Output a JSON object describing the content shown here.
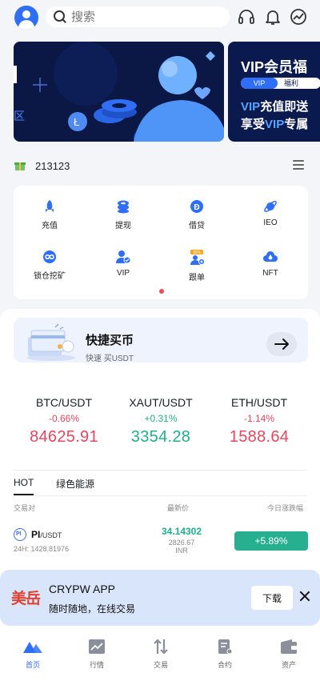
{
  "header": {
    "search_placeholder": "搜索",
    "icons": [
      "headset-icon",
      "bell-icon",
      "chart-globe-icon"
    ]
  },
  "banners": {
    "vip": {
      "title": "VIP会员福",
      "pill_left": "VIP",
      "pill_right": "福利",
      "line1_a": "VIP",
      "line1_b": "充值即送",
      "line2_a": "享受",
      "line2_b": "VIP",
      "line2_c": "专属"
    }
  },
  "notice": {
    "text": "213123"
  },
  "quick_grid": [
    {
      "label": "充值",
      "icon": "rocket-icon"
    },
    {
      "label": "提现",
      "icon": "coins-stack-icon"
    },
    {
      "label": "借贷",
      "icon": "dollar-coin-icon"
    },
    {
      "label": "IEO",
      "icon": "planet-icon"
    },
    {
      "label": "锁仓挖矿",
      "icon": "infinity-lock-icon"
    },
    {
      "label": "VIP",
      "icon": "user-check-icon"
    },
    {
      "label": "跟单",
      "icon": "follow-order-icon",
      "badge": "30%"
    },
    {
      "label": "NFT",
      "icon": "cloud-drop-icon"
    }
  ],
  "quick_buy": {
    "title": "快捷买币",
    "subtitle": "快速 买USDT"
  },
  "tickers": [
    {
      "pair": "BTC/USDT",
      "change": "-0.66%",
      "price": "84625.91",
      "trend": "down"
    },
    {
      "pair": "XAUT/USDT",
      "change": "+0.31%",
      "price": "3354.28",
      "trend": "up"
    },
    {
      "pair": "ETH/USDT",
      "change": "-1.14%",
      "price": "1588.64",
      "trend": "down"
    }
  ],
  "market_tabs": [
    {
      "label": "HOT",
      "active": true
    },
    {
      "label": "绿色能源",
      "active": false
    }
  ],
  "market_columns": {
    "pair": "交易对",
    "price": "最新价",
    "change": "今日涨跌幅"
  },
  "market_rows": [
    {
      "icon_text": "PI",
      "base": "PI",
      "quote": "/USDT",
      "volume": "24H: 1428.81976",
      "price": "34.14302",
      "price_local": "2826.67",
      "currency": "INR",
      "change": "+5.89%"
    }
  ],
  "app_banner": {
    "logo": "美岳",
    "title": "CRYPW APP",
    "subtitle": "随时随地，在线交易",
    "download": "下载"
  },
  "nav": [
    {
      "label": "首页",
      "active": true
    },
    {
      "label": "行情",
      "active": false
    },
    {
      "label": "交易",
      "active": false
    },
    {
      "label": "合约",
      "active": false
    },
    {
      "label": "资产",
      "active": false
    }
  ],
  "colors": {
    "accent": "#2f6ef6",
    "up": "#22ae8c",
    "down": "#e54660",
    "banner_bg": "#0b1846"
  }
}
